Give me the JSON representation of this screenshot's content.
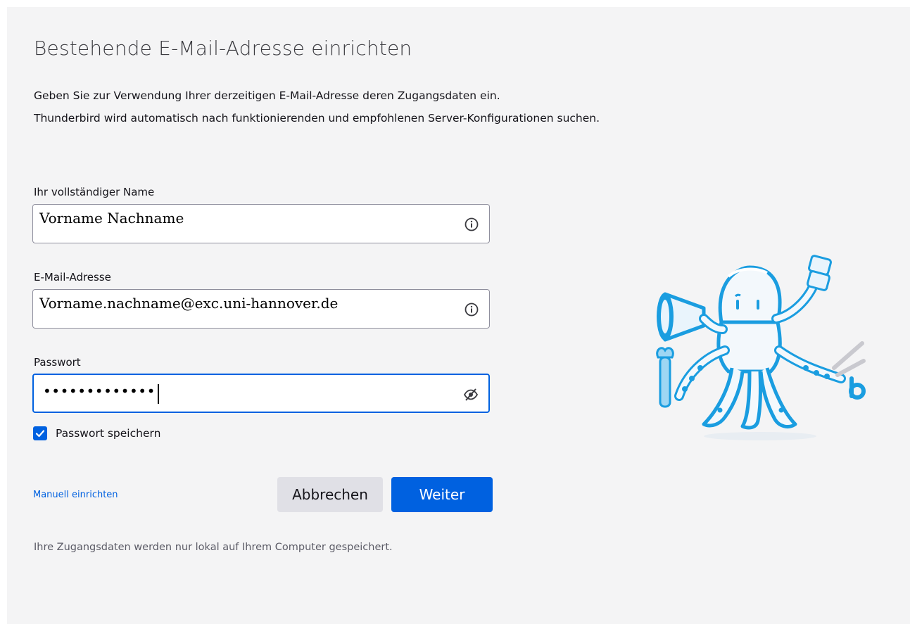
{
  "header": {
    "title": "Bestehende E-Mail-Adresse einrichten",
    "intro_line1": "Geben Sie zur Verwendung Ihrer derzeitigen E-Mail-Adresse deren Zugangsdaten ein.",
    "intro_line2": "Thunderbird wird automatisch nach funktionierenden und empfohlenen Server-Konfigurationen suchen."
  },
  "form": {
    "name": {
      "label": "Ihr vollständiger Name",
      "value": "Vorname Nachname",
      "icon": "info-icon"
    },
    "email": {
      "label": "E-Mail-Adresse",
      "value": "Vorname.nachname@exc.uni-hannover.de",
      "icon": "info-icon"
    },
    "password": {
      "label": "Passwort",
      "masked_value": "•••••••••••••",
      "icon": "eye-slash-icon",
      "focused": true
    },
    "remember_password": {
      "label": "Passwort speichern",
      "checked": true
    }
  },
  "actions": {
    "manual_setup": "Manuell einrichten",
    "cancel": "Abbrechen",
    "continue": "Weiter"
  },
  "footer": {
    "note": "Ihre Zugangsdaten werden nur lokal auf Ihrem Computer gespeichert."
  },
  "colors": {
    "accent": "#0061e0",
    "background": "#f4f4f5",
    "mascot_blue": "#1a9de0"
  }
}
